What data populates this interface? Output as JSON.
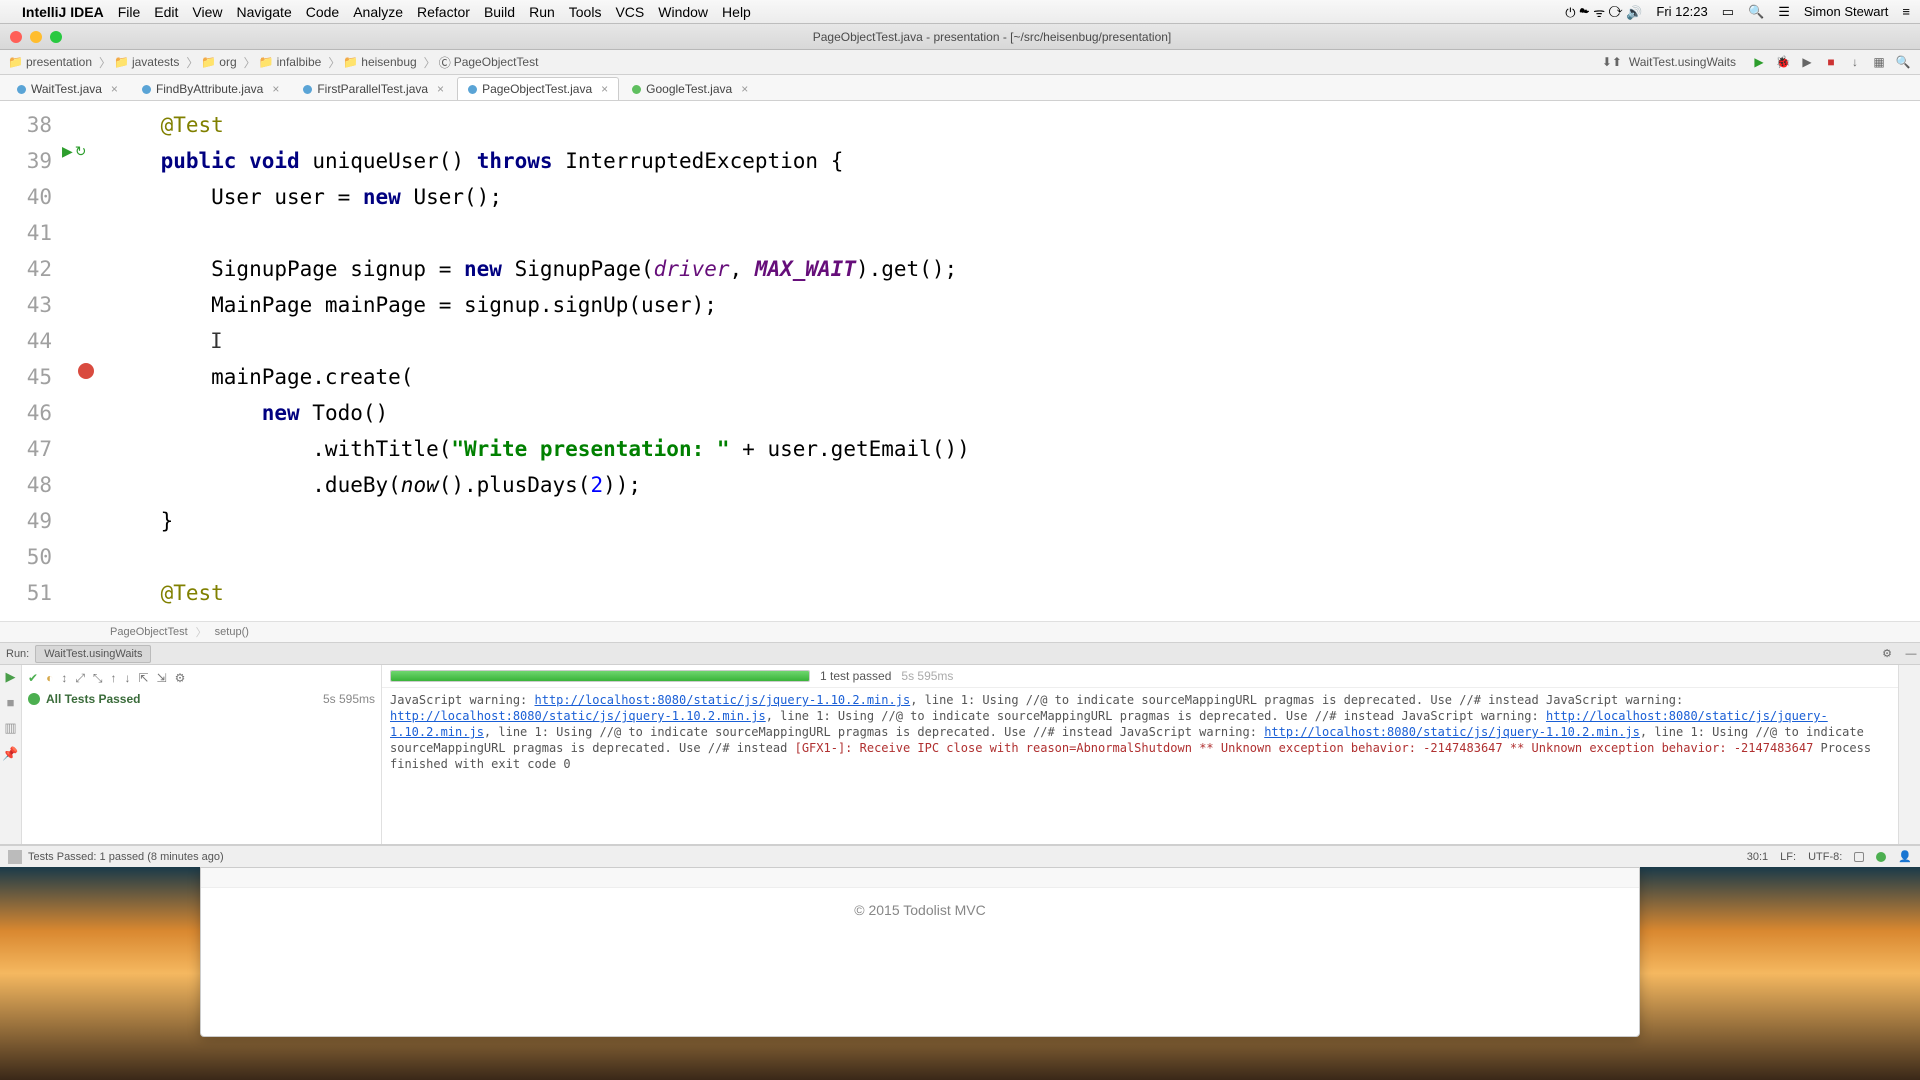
{
  "menubar": {
    "app": "IntelliJ IDEA",
    "items": [
      "File",
      "Edit",
      "View",
      "Navigate",
      "Code",
      "Analyze",
      "Refactor",
      "Build",
      "Run",
      "Tools",
      "VCS",
      "Window",
      "Help"
    ],
    "clock": "Fri 12:23",
    "user": "Simon Stewart"
  },
  "window_title": "PageObjectTest.java - presentation - [~/src/heisenbug/presentation]",
  "breadcrumbs": [
    "presentation",
    "javatests",
    "org",
    "infalbibe",
    "heisenbug",
    "PageObjectTest"
  ],
  "run_config": "WaitTest.usingWaits",
  "tabs": [
    {
      "label": "WaitTest.java",
      "color": "#5aa4d6"
    },
    {
      "label": "FindByAttribute.java",
      "color": "#5aa4d6"
    },
    {
      "label": "FirstParallelTest.java",
      "color": "#5aa4d6"
    },
    {
      "label": "PageObjectTest.java",
      "color": "#5aa4d6",
      "active": true
    },
    {
      "label": "GoogleTest.java",
      "color": "#5fbf5f"
    }
  ],
  "line_start": 38,
  "line_end": 51,
  "breakpoint_line": 45,
  "code": {
    "l38": "@Test",
    "l39_kw1": "public",
    "l39_kw2": "void",
    "l39_name": "uniqueUser()",
    "l39_kw3": "throws",
    "l39_exc": "InterruptedException {",
    "l40_a": "        User user = ",
    "l40_kw": "new",
    "l40_b": " User();",
    "l41": "",
    "l42_a": "        SignupPage signup = ",
    "l42_kw": "new",
    "l42_b": " SignupPage(",
    "l42_drv": "driver",
    "l42_c": ", ",
    "l42_mw": "MAX_WAIT",
    "l42_d": ").get();",
    "l43": "        MainPage mainPage = signup.signUp(user);",
    "l44": "        ",
    "l45": "        mainPage.create(",
    "l46_a": "            ",
    "l46_kw": "new",
    "l46_b": " Todo()",
    "l47_a": "                .withTitle(",
    "l47_str": "\"Write presentation: \"",
    "l47_b": " + user.getEmail())",
    "l48_a": "                .dueBy(",
    "l48_fn": "now",
    "l48_b": "().plusDays(",
    "l48_num": "2",
    "l48_c": "));",
    "l49": "    }",
    "l50": "",
    "l51": "@Test"
  },
  "editor_crumbs": {
    "a": "PageObjectTest",
    "b": "setup()"
  },
  "run_panel": {
    "header_label": "Run:",
    "header_tab": "WaitTest.usingWaits",
    "tree_root": "All Tests Passed",
    "tree_time": "5s 595ms",
    "progress_label": "1 test passed",
    "progress_time": "5s 595ms",
    "warn_prefix": "JavaScript warning: ",
    "warn_url": "http://localhost:8080/static/js/jquery-1.10.2.min.js",
    "warn_suffix": ", line 1: Using //@ to indicate sourceMappingURL pragmas is deprecated. Use //# instead",
    "gfx": "[GFX1-]: Receive IPC close with reason=AbnormalShutdown",
    "unk": "** Unknown exception behavior: -2147483647",
    "exit": "Process finished with exit code 0"
  },
  "status_bar": {
    "msg": "Tests Passed: 1 passed (8 minutes ago)",
    "pos": "30:1",
    "sep": "LF:",
    "enc": "UTF-8:"
  },
  "browser_footer": "© 2015 Todolist MVC"
}
